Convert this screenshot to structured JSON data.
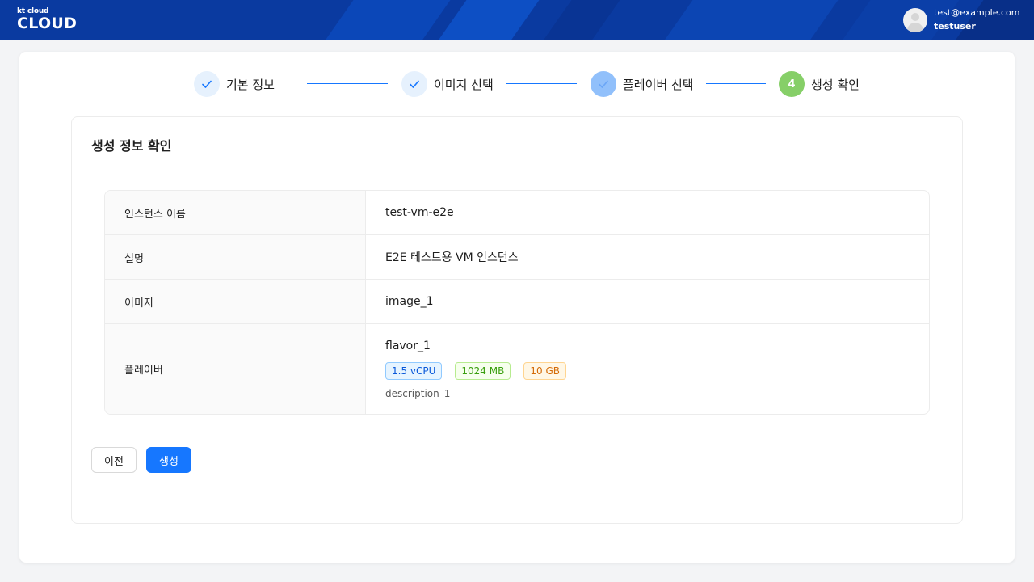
{
  "header": {
    "logo_small": "kt cloud",
    "logo_large": "CLOUD",
    "user_email": "test@example.com",
    "username": "testuser",
    "avatar_icon": "user-avatar-icon"
  },
  "steps": [
    {
      "label": "기본 정보",
      "status": "done",
      "icon": "check-icon"
    },
    {
      "label": "이미지 선택",
      "status": "done",
      "icon": "check-icon"
    },
    {
      "label": "플레이버 선택",
      "status": "active",
      "icon": "check-icon"
    },
    {
      "label": "생성 확인",
      "status": "current",
      "number": "4"
    }
  ],
  "panel": {
    "title": "생성 정보 확인",
    "rows": [
      {
        "label": "인스턴스 이름",
        "value": "test-vm-e2e"
      },
      {
        "label": "설명",
        "value": "E2E 테스트용 VM 인스턴스"
      },
      {
        "label": "이미지",
        "value": "image_1"
      },
      {
        "label": "플레이버",
        "value": "flavor_1"
      }
    ],
    "flavor": {
      "name": "flavor_1",
      "vcpu": "1.5 vCPU",
      "memory": "1024 MB",
      "disk": "10 GB",
      "description": "description_1"
    }
  },
  "buttons": {
    "prev": "이전",
    "create": "생성"
  },
  "colors": {
    "header": "#0a3aa0",
    "primary": "#1677ff",
    "step_done_bg": "#e6f1fd",
    "step_active_bg": "#91c0fb",
    "step_current_bg": "#86cf68"
  }
}
